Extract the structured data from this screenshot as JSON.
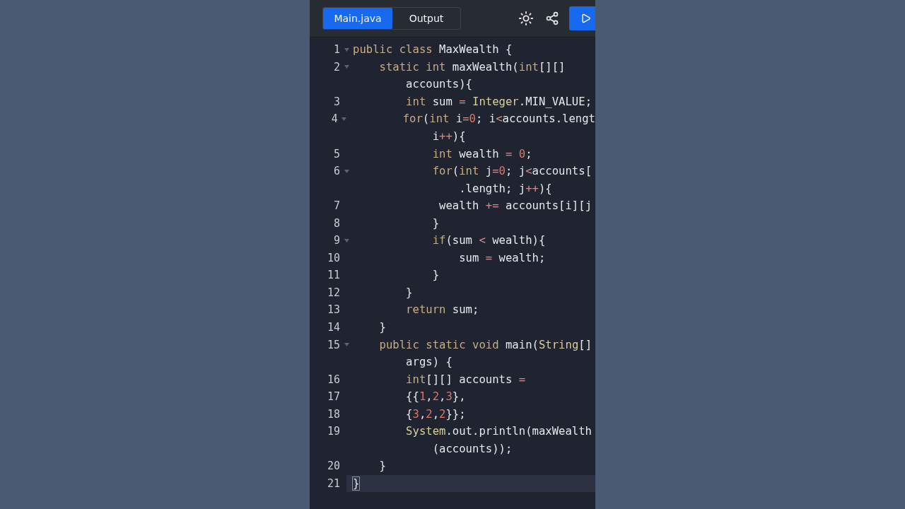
{
  "tabs": [
    {
      "label": "Main.java",
      "selected": true
    },
    {
      "label": "Output",
      "selected": false
    }
  ],
  "lines": [
    {
      "number": "1",
      "foldable": true,
      "active": false,
      "rows": [
        "public class MaxWealth {"
      ]
    },
    {
      "number": "2",
      "foldable": true,
      "active": false,
      "rows": [
        "    static int maxWealth(int[][]",
        "        accounts){"
      ]
    },
    {
      "number": "3",
      "foldable": false,
      "active": false,
      "rows": [
        "        int sum = Integer.MIN_VALUE;"
      ]
    },
    {
      "number": "4",
      "foldable": true,
      "active": false,
      "rows": [
        "        for(int i=0; i<accounts.lengt",
        "            i++){"
      ]
    },
    {
      "number": "5",
      "foldable": false,
      "active": false,
      "rows": [
        "            int wealth = 0;"
      ]
    },
    {
      "number": "6",
      "foldable": true,
      "active": false,
      "rows": [
        "            for(int j=0; j<accounts[",
        "                .length; j++){"
      ]
    },
    {
      "number": "7",
      "foldable": false,
      "active": false,
      "rows": [
        "             wealth += accounts[i][j"
      ]
    },
    {
      "number": "8",
      "foldable": false,
      "active": false,
      "rows": [
        "            }"
      ]
    },
    {
      "number": "9",
      "foldable": true,
      "active": false,
      "rows": [
        "            if(sum < wealth){"
      ]
    },
    {
      "number": "10",
      "foldable": false,
      "active": false,
      "rows": [
        "                sum = wealth;"
      ]
    },
    {
      "number": "11",
      "foldable": false,
      "active": false,
      "rows": [
        "            }"
      ]
    },
    {
      "number": "12",
      "foldable": false,
      "active": false,
      "rows": [
        "        }"
      ]
    },
    {
      "number": "13",
      "foldable": false,
      "active": false,
      "rows": [
        "        return sum;"
      ]
    },
    {
      "number": "14",
      "foldable": false,
      "active": false,
      "rows": [
        "    }"
      ]
    },
    {
      "number": "15",
      "foldable": true,
      "active": false,
      "rows": [
        "    public static void main(String[]",
        "        args) {"
      ]
    },
    {
      "number": "16",
      "foldable": false,
      "active": false,
      "rows": [
        "        int[][] accounts ="
      ]
    },
    {
      "number": "17",
      "foldable": false,
      "active": false,
      "rows": [
        "        {{1,2,3},"
      ]
    },
    {
      "number": "18",
      "foldable": false,
      "active": false,
      "rows": [
        "        {3,2,2}};"
      ]
    },
    {
      "number": "19",
      "foldable": false,
      "active": false,
      "rows": [
        "        System.out.println(maxWealth",
        "            (accounts));"
      ]
    },
    {
      "number": "20",
      "foldable": false,
      "active": false,
      "rows": [
        "    }"
      ]
    },
    {
      "number": "21",
      "foldable": false,
      "active": true,
      "rows": [
        "}"
      ]
    }
  ]
}
